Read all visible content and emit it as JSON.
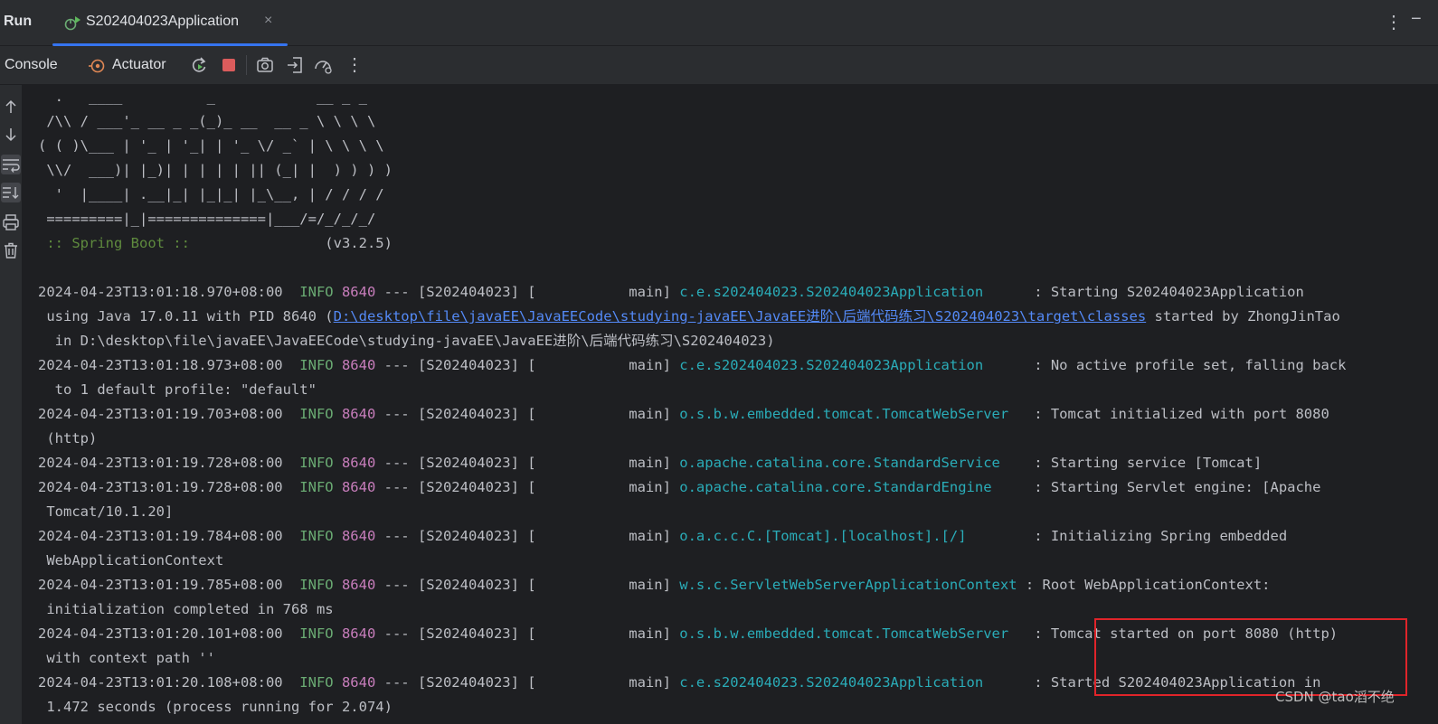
{
  "topbar": {
    "run_title": "Run",
    "tab_label": "S202404023Application",
    "tab_close": "×",
    "more": "⋮",
    "minimize": "−"
  },
  "toolbar": {
    "console_label": "Console",
    "actuator_label": "Actuator",
    "more": "⋮"
  },
  "banner": [
    "  .   ____          _            __ _ _",
    " /\\\\ / ___'_ __ _ _(_)_ __  __ _ \\ \\ \\ \\",
    "( ( )\\___ | '_ | '_| | '_ \\/ _` | \\ \\ \\ \\",
    " \\\\/  ___)| |_)| | | | | || (_| |  ) ) ) )",
    "  '  |____| .__|_| |_|_| |_\\__, | / / / /",
    " =========|_|==============|___/=/_/_/_/"
  ],
  "boot": {
    "label": " :: Spring Boot ::",
    "version": "                (v3.2.5)"
  },
  "log": [
    {
      "ts": "2024-04-23T13:01:18.970+08:00",
      "level": "INFO",
      "pid": "8640",
      "mid": " --- [S202404023] [           main] ",
      "logger": "c.e.s202404023.S202404023Application     ",
      "msg": " : Starting S202404023Application",
      "cont": [
        " using Java 17.0.11 with PID 8640 ("
      ],
      "link": "D:\\desktop\\file\\javaEE\\JavaEECode\\studying-javaEE\\JavaEE进阶\\后端代码练习\\S202404023\\target\\classes",
      "after_link": " started by ZhongJinTao",
      "cont2": "  in D:\\desktop\\file\\javaEE\\JavaEECode\\studying-javaEE\\JavaEE进阶\\后端代码练习\\S202404023)"
    },
    {
      "ts": "2024-04-23T13:01:18.973+08:00",
      "level": "INFO",
      "pid": "8640",
      "mid": " --- [S202404023] [           main] ",
      "logger": "c.e.s202404023.S202404023Application     ",
      "msg": " : No active profile set, falling back",
      "cont": [
        "  to 1 default profile: \"default\""
      ]
    },
    {
      "ts": "2024-04-23T13:01:19.703+08:00",
      "level": "INFO",
      "pid": "8640",
      "mid": " --- [S202404023] [           main] ",
      "logger": "o.s.b.w.embedded.tomcat.TomcatWebServer  ",
      "msg": " : Tomcat initialized with port 8080",
      "cont": [
        " (http)"
      ]
    },
    {
      "ts": "2024-04-23T13:01:19.728+08:00",
      "level": "INFO",
      "pid": "8640",
      "mid": " --- [S202404023] [           main] ",
      "logger": "o.apache.catalina.core.StandardService   ",
      "msg": " : Starting service [Tomcat]",
      "cont": []
    },
    {
      "ts": "2024-04-23T13:01:19.728+08:00",
      "level": "INFO",
      "pid": "8640",
      "mid": " --- [S202404023] [           main] ",
      "logger": "o.apache.catalina.core.StandardEngine    ",
      "msg": " : Starting Servlet engine: [Apache",
      "cont": [
        " Tomcat/10.1.20]"
      ]
    },
    {
      "ts": "2024-04-23T13:01:19.784+08:00",
      "level": "INFO",
      "pid": "8640",
      "mid": " --- [S202404023] [           main] ",
      "logger": "o.a.c.c.C.[Tomcat].[localhost].[/]       ",
      "msg": " : Initializing Spring embedded",
      "cont": [
        " WebApplicationContext"
      ]
    },
    {
      "ts": "2024-04-23T13:01:19.785+08:00",
      "level": "INFO",
      "pid": "8640",
      "mid": " --- [S202404023] [           main] ",
      "logger": "w.s.c.ServletWebServerApplicationContext ",
      "msg": ": Root WebApplicationContext:",
      "cont": [
        " initialization completed in 768 ms"
      ]
    },
    {
      "ts": "2024-04-23T13:01:20.101+08:00",
      "level": "INFO",
      "pid": "8640",
      "mid": " --- [S202404023] [           main] ",
      "logger": "o.s.b.w.embedded.tomcat.TomcatWebServer  ",
      "msg": " : Tomcat started on port 8080 (http)",
      "cont": [
        " with context path ''"
      ]
    },
    {
      "ts": "2024-04-23T13:01:20.108+08:00",
      "level": "INFO",
      "pid": "8640",
      "mid": " --- [S202404023] [           main] ",
      "logger": "c.e.s202404023.S202404023Application     ",
      "msg": " : Started S202404023Application in",
      "cont": [
        " 1.472 seconds (process running for 2.074)"
      ]
    }
  ],
  "watermark": "CSDN @tao滔不绝",
  "icons": {
    "tab": "spring-boot-run-icon",
    "actuator": "actuator-icon",
    "rerun": "rerun-icon",
    "stop": "stop-icon",
    "screenshot": "camera-icon",
    "exit": "exit-icon",
    "profiler": "gauge-icon",
    "up": "arrow-up-icon",
    "down": "arrow-down-icon",
    "wrap": "soft-wrap-icon",
    "scroll_end": "scroll-to-end-icon",
    "print": "print-icon",
    "clear": "trash-icon"
  },
  "colors": {
    "accent": "#3574f0",
    "stop": "#db5c5c",
    "info": "#6aab73",
    "pid": "#c77dbb",
    "logger": "#2aacb8",
    "link": "#548af7",
    "highlight": "#e0242a"
  }
}
